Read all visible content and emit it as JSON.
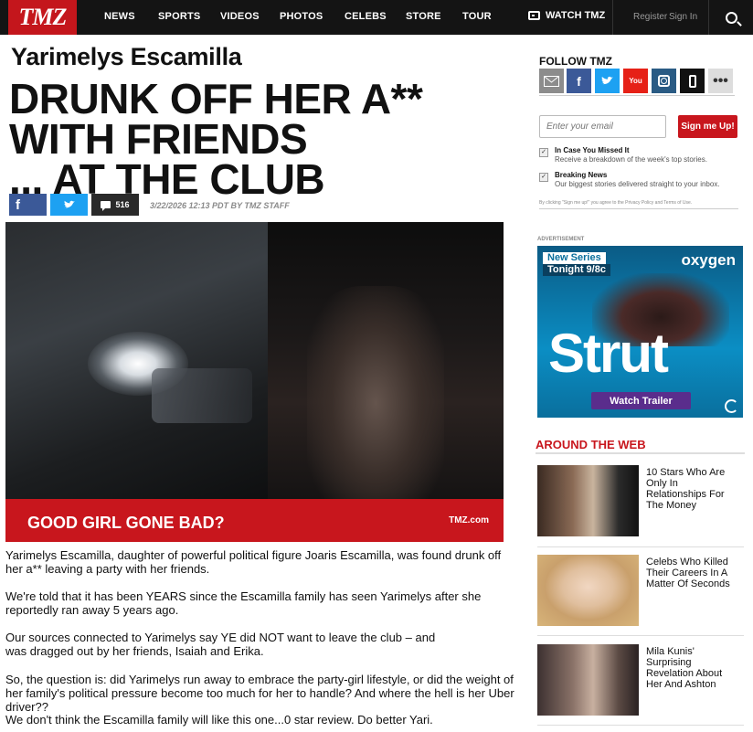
{
  "nav": {
    "logo": "TMZ",
    "items": [
      "NEWS",
      "SPORTS",
      "VIDEOS",
      "PHOTOS",
      "CELEBS",
      "STORE",
      "TOUR"
    ],
    "watch": "WATCH TMZ",
    "register": "Register",
    "signin": "Sign In"
  },
  "article": {
    "subject": "Yarimelys Escamilla",
    "headline_lines": [
      "DRUNK OFF HER A**",
      "WITH  FRIENDS",
      "... AT THE CLUB"
    ],
    "comment_count": "516",
    "timestamp": "3/22/2026 12:13 PDT BY TMZ STAFF",
    "photo_caption": "GOOD GIRL GONE BAD?",
    "photo_brand": "TMZ.com",
    "paragraphs": [
      "Yarimelys Escamilla, daughter of powerful political figure Joaris Escamilla, was found drunk off her a** leaving a party with her friends.",
      "We're told that it has been YEARS since the Escamilla family has seen Yarimelys after she reportedly ran away 5 years ago.",
      "Our sources connected to Yarimelys say YE did NOT want to leave the club – and was dragged out by her friends, Isaiah and Erika.",
      "So, the question is: did Yarimelys run away to embrace the party-girl lifestyle, or did the weight of her family's political pressure become too much for her to handle? And where the hell is her Uber driver??",
      "We don't think the Escamilla family will like this one...0 star review. Do better Yari."
    ]
  },
  "sidebar": {
    "follow_title": "FOLLOW TMZ",
    "social_icons": [
      "email-icon",
      "facebook-icon",
      "twitter-icon",
      "youtube-icon",
      "instagram-icon",
      "mobile-icon",
      "more-icon"
    ],
    "email_placeholder": "Enter your email",
    "signup_label": "Sign me Up!",
    "options": [
      {
        "title": "In Case You Missed It",
        "desc": "Receive a breakdown of the week's top stories."
      },
      {
        "title": "Breaking News",
        "desc": "Our biggest stories delivered straight to your inbox."
      }
    ],
    "fine_print": "By clicking \"Sign me up!\" you agree to the Privacy Policy and Terms of Use.",
    "ad_label": "ADVERTISEMENT",
    "ad": {
      "line1": "New Series",
      "line2": "Tonight 9/8c",
      "brand": "oxygen",
      "title": "Strut",
      "button": "Watch Trailer"
    },
    "around_title": "AROUND THE WEB",
    "around_items": [
      "10 Stars Who Are Only In Relationships For The Money",
      "Celebs Who Killed Their Careers In A Matter Of Seconds",
      "Mila Kunis' Surprising Revelation About Her And Ashton"
    ]
  },
  "colors": {
    "brand_red": "#c8161d",
    "nav_bg": "#141414",
    "facebook": "#3b5998",
    "twitter": "#1da1f2"
  }
}
